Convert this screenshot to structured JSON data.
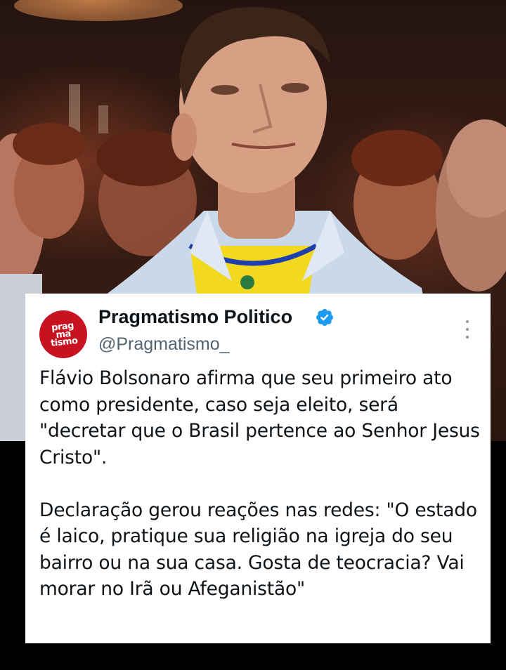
{
  "tweet": {
    "display_name": "Pragmatismo Politico",
    "handle": "@Pragmatismo_",
    "avatar_mark": [
      "prag",
      "ma",
      "tismo"
    ],
    "verified": true,
    "paragraphs": [
      "Flávio Bolsonaro afirma que seu primeiro ato como presidente, caso seja eleito, será \"decretar que o Brasil pertence ao Senhor Jesus Cristo\".",
      "Declaração gerou reações nas redes: \"O estado é laico, pratique sua religião na igreja do seu bairro ou na sua casa. Gosta de teocracia? Vai morar no Irã ou Afeganistão\""
    ]
  },
  "icons": {
    "verified": "verified-badge-icon",
    "more": "more-options-icon"
  },
  "colors": {
    "avatar_bg": "#c81220",
    "verified_blue": "#1d9bf0",
    "handle_gray": "#536471",
    "text": "#0f1419"
  }
}
